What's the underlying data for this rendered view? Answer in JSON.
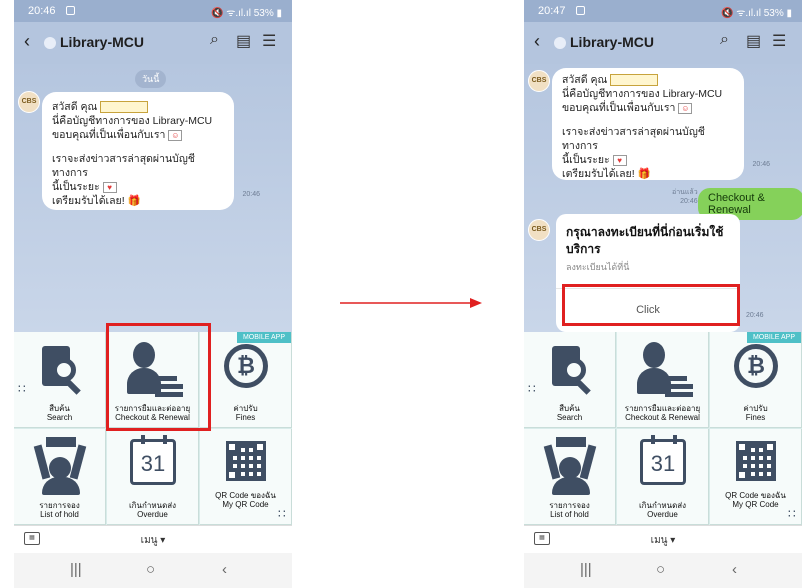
{
  "accent_colors": {
    "highlight": "#e02020",
    "user_bubble": "#85d15a",
    "menu_icon": "#3f4e63"
  },
  "left_screen": {
    "status_time": "20:46",
    "status_right": "🔇 ᯤ.ıl.ıl 53% ▮",
    "header_title": "Library-MCU",
    "day_label": "วันนี้",
    "bot_avatar": "CBS",
    "greeting": {
      "line1": "สวัสดี คุณ",
      "line2": "นี่คือบัญชีทางการของ Library-MCU",
      "line3": "ขอบคุณที่เป็นเพื่อนกับเรา",
      "line4": "เราจะส่งข่าวสารล่าสุดผ่านบัญชีทางการ",
      "line5": "นี้เป็นระยะ",
      "line6": "เตรียมรับได้เลย!",
      "time": "20:46"
    },
    "menu": {
      "badge": "MOBILE APP",
      "search": {
        "th": "สืบค้น",
        "en": "Search"
      },
      "checkout": {
        "th": "รายการยืมและต่ออายุ",
        "en": "Checkout & Renewal"
      },
      "fines": {
        "th": "ค่าปรับ",
        "en": "Fines"
      },
      "hold": {
        "th": "รายการจอง",
        "en": "List of hold"
      },
      "overdue": {
        "th": "เกินกำหนดส่ง",
        "en": "Overdue",
        "day": "31"
      },
      "qr": {
        "th": "QR Code ของฉัน",
        "en": "My QR Code"
      }
    },
    "menu_toggle": "เมนู ▾"
  },
  "right_screen": {
    "status_time": "20:47",
    "status_right": "🔇 ᯤ.ıl.ıl 53% ▮",
    "header_title": "Library-MCU",
    "bot_avatar": "CBS",
    "greeting": {
      "line1": "สวัสดี คุณ",
      "line2": "นี่คือบัญชีทางการของ Library-MCU",
      "line3": "ขอบคุณที่เป็นเพื่อนกับเรา",
      "line4": "เราจะส่งข่าวสารล่าสุดผ่านบัญชีทางการ",
      "line5": "นี้เป็นระยะ",
      "line6": "เตรียมรับได้เลย!",
      "time": "20:46"
    },
    "user_message": "Checkout & Renewal",
    "read_label": "อ่านแล้ว",
    "read_time": "20:46",
    "card": {
      "title": "กรุณาลงทะเบียนที่นี่ก่อนเริ่มใช้บริการ",
      "subtitle": "ลงทะเบียนได้ที่นี่",
      "button": "Click",
      "time": "20:46"
    },
    "menu": {
      "badge": "MOBILE APP",
      "search": {
        "th": "สืบค้น",
        "en": "Search"
      },
      "checkout": {
        "th": "รายการยืมและต่ออายุ",
        "en": "Checkout & Renewal"
      },
      "fines": {
        "th": "ค่าปรับ",
        "en": "Fines"
      },
      "hold": {
        "th": "รายการจอง",
        "en": "List of hold"
      },
      "overdue": {
        "th": "เกินกำหนดส่ง",
        "en": "Overdue",
        "day": "31"
      },
      "qr": {
        "th": "QR Code ของฉัน",
        "en": "My QR Code"
      }
    },
    "menu_toggle": "เมนู ▾"
  },
  "nav": {
    "recents": "|||",
    "home": "○",
    "back": "‹"
  },
  "icons": {
    "back": "‹",
    "search": "⌕",
    "notes": "▤",
    "menu": "☰",
    "gift": "🎁",
    "heart": "♥"
  }
}
